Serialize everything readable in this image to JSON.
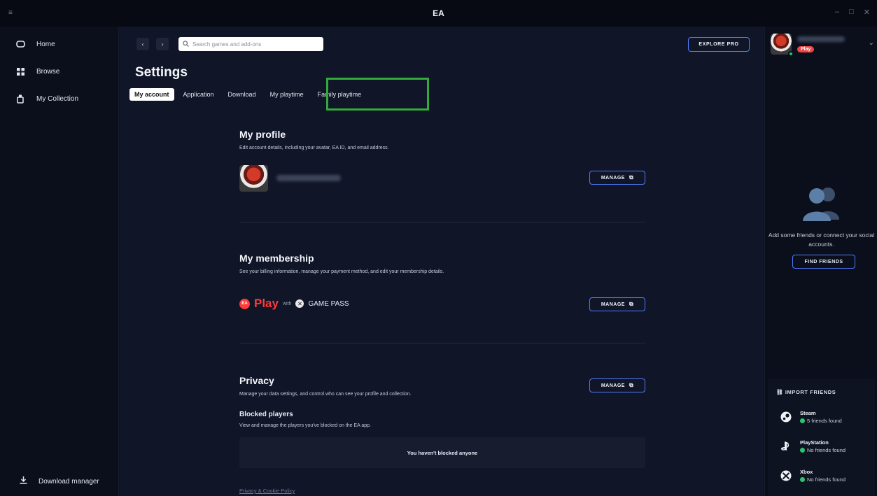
{
  "window": {
    "title": "EA",
    "menu": "≡",
    "minimize": "–",
    "maximize": "□",
    "close": "✕"
  },
  "nav": {
    "items": [
      {
        "label": "Home",
        "icon": "home-icon"
      },
      {
        "label": "Browse",
        "icon": "grid-icon"
      },
      {
        "label": "My Collection",
        "icon": "collection-icon"
      }
    ],
    "download_manager": "Download manager"
  },
  "topbar": {
    "back": "‹",
    "forward": "›",
    "search_placeholder": "Search games and add-ons",
    "explore_pro": "EXPLORE PRO"
  },
  "page": {
    "title": "Settings",
    "tabs": [
      {
        "label": "My account",
        "active": true
      },
      {
        "label": "Application"
      },
      {
        "label": "Download"
      },
      {
        "label": "My playtime"
      },
      {
        "label": "Family playtime"
      }
    ]
  },
  "profile": {
    "title": "My profile",
    "description": "Edit account details, including your avatar, EA ID, and email address.",
    "manage": "MANAGE"
  },
  "membership": {
    "title": "My membership",
    "description": "See your billing information, manage your payment method, and edit your membership details.",
    "ea_badge": "EA",
    "play": "Play",
    "with": "with",
    "gamepass": "GAME PASS",
    "manage": "MANAGE"
  },
  "privacy": {
    "title": "Privacy",
    "description": "Manage your data settings, and control who can see your profile and collection.",
    "manage": "MANAGE",
    "blocked_title": "Blocked players",
    "blocked_description": "View and manage the players you've blocked on the EA app.",
    "blocked_empty": "You haven't blocked anyone",
    "policy_link": "Privacy & Cookie Policy"
  },
  "friends": {
    "play_badge": "Play",
    "empty_text": "Add some friends or connect your social accounts.",
    "find_friends": "FIND FRIENDS",
    "import_title": "IMPORT FRIENDS",
    "import": [
      {
        "name": "Steam",
        "status": "5 friends found",
        "icon": "steam-icon"
      },
      {
        "name": "PlayStation",
        "status": "No friends found",
        "icon": "playstation-icon"
      },
      {
        "name": "Xbox",
        "status": "No friends found",
        "icon": "xbox-icon"
      }
    ]
  },
  "colors": {
    "accent": "#4f7cff",
    "highlight": "#33a93a",
    "online": "#27c26b",
    "ea_red": "#ff3b3b"
  }
}
